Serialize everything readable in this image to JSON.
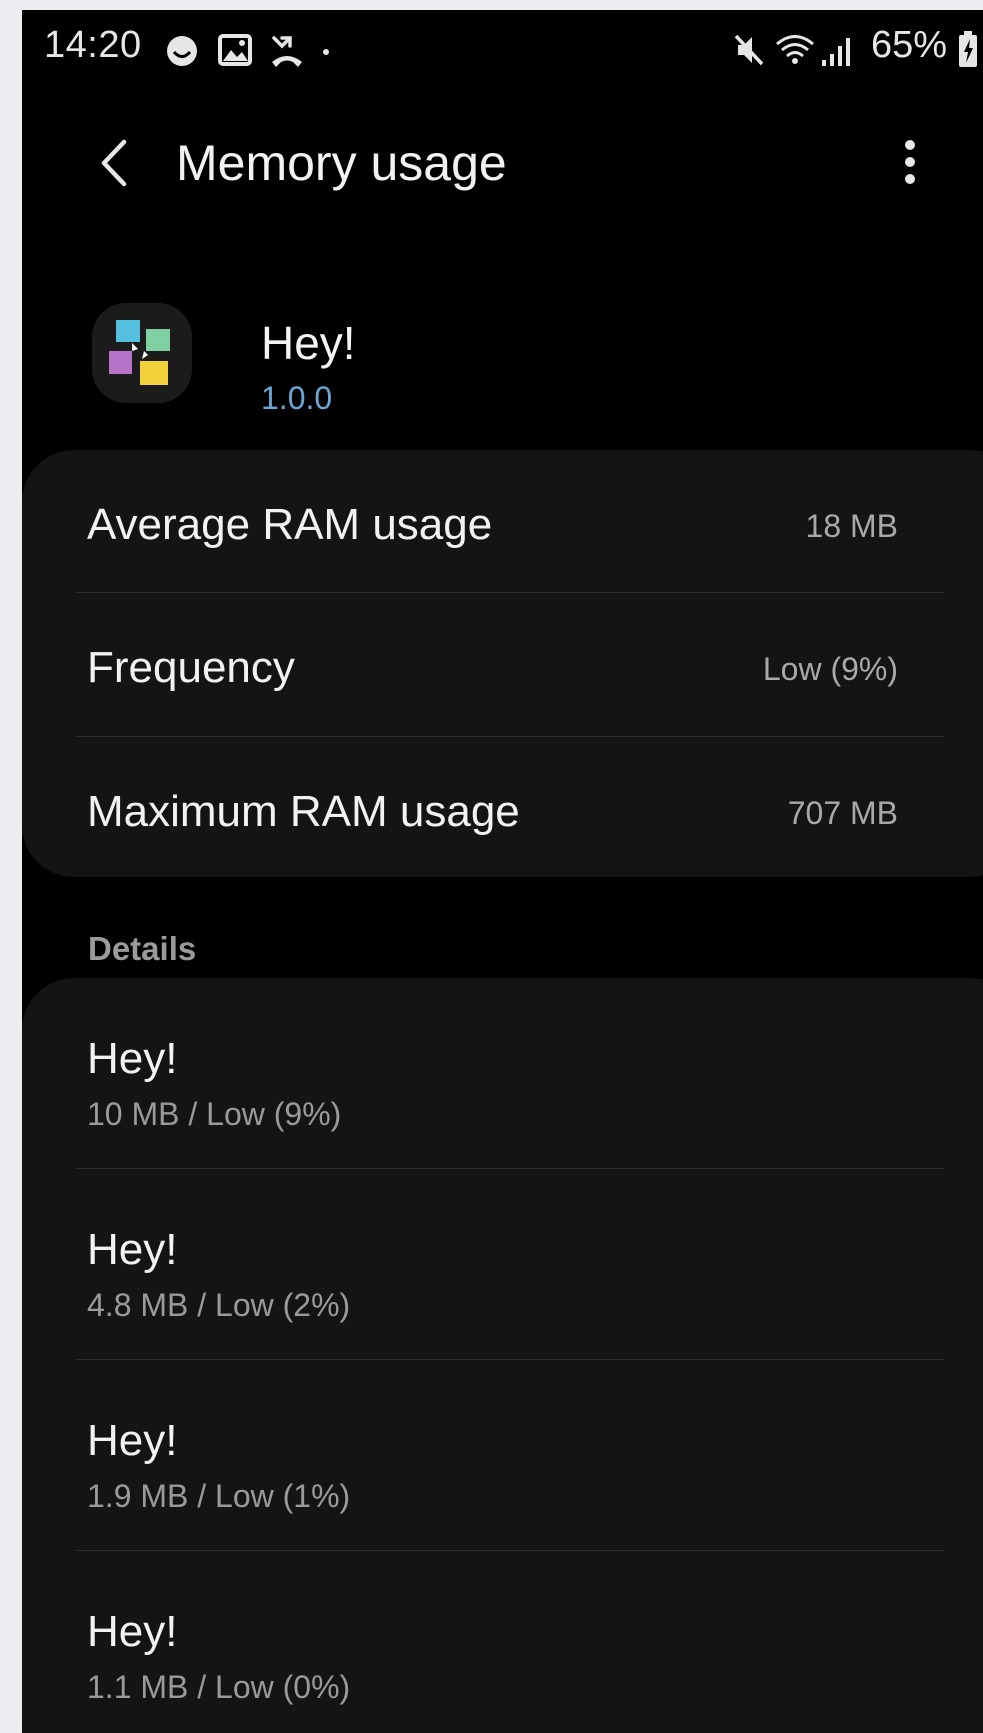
{
  "status_bar": {
    "time": "14:20",
    "battery": "65%",
    "icons_left": [
      "smiley-notification-icon",
      "gallery-notification-icon",
      "missed-call-icon",
      "dot-icon"
    ],
    "icons_right": [
      "mute-icon",
      "wifi-icon",
      "signal-icon",
      "battery-charging-icon"
    ]
  },
  "app_bar": {
    "title": "Memory usage",
    "back_icon": "chevron-left-icon",
    "more_icon": "more-vert-icon"
  },
  "app": {
    "name": "Hey!",
    "version": "1.0.0"
  },
  "summary": [
    {
      "label": "Average RAM usage",
      "value": "18 MB"
    },
    {
      "label": "Frequency",
      "value": "Low (9%)"
    },
    {
      "label": "Maximum RAM usage",
      "value": "707 MB"
    }
  ],
  "details_header": "Details",
  "details": [
    {
      "title": "Hey!",
      "subtitle": "10 MB / Low (9%)"
    },
    {
      "title": "Hey!",
      "subtitle": "4.8 MB / Low (2%)"
    },
    {
      "title": "Hey!",
      "subtitle": "1.9 MB / Low (1%)"
    },
    {
      "title": "Hey!",
      "subtitle": "1.1 MB / Low (0%)"
    }
  ],
  "colors": {
    "background": "#000000",
    "card": "#141414",
    "accent_version": "#6ba7d6"
  }
}
